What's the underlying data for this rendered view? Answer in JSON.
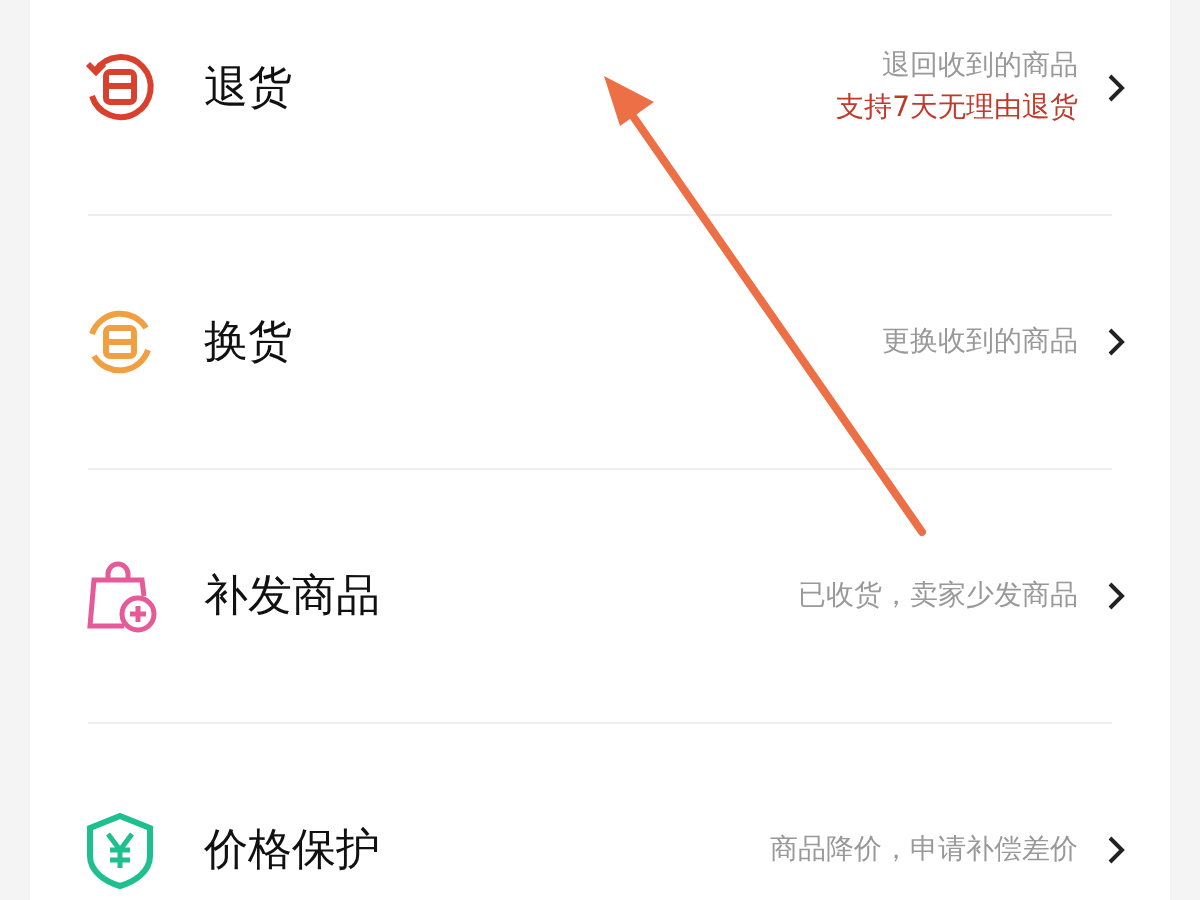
{
  "options": [
    {
      "kind": "return",
      "title": "退货",
      "description": "退回收到的商品",
      "note": "支持7天无理由退货"
    },
    {
      "kind": "exchange",
      "title": "换货",
      "description": "更换收到的商品"
    },
    {
      "kind": "reissue",
      "title": "补发商品",
      "description": "已收货，卖家少发商品"
    },
    {
      "kind": "price",
      "title": "价格保护",
      "description": "商品降价，申请补偿差价"
    }
  ]
}
